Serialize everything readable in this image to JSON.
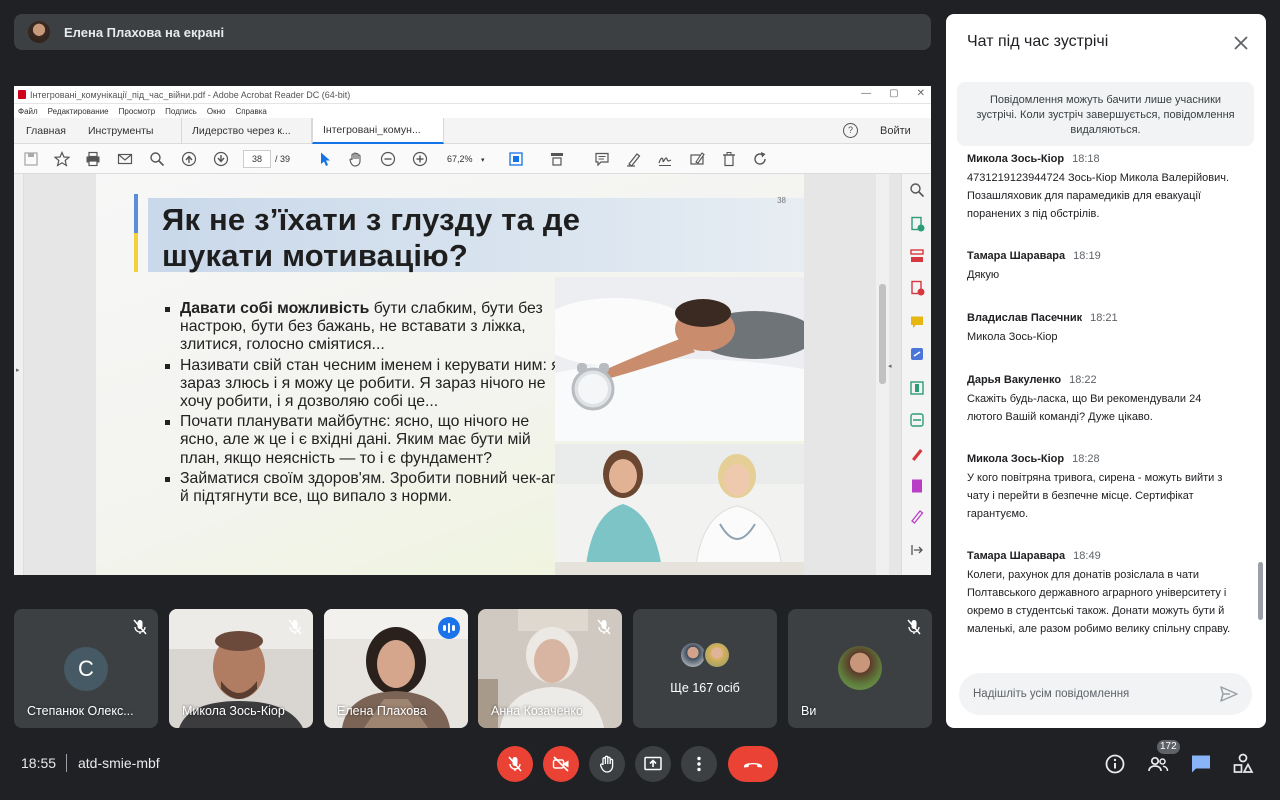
{
  "presenter": {
    "text": "Елена Плахова на екрані"
  },
  "acrobat": {
    "window_title": "Інтегровані_комунікації_під_час_війни.pdf - Adobe Acrobat Reader DC (64-bit)",
    "menu": [
      "Файл",
      "Редактирование",
      "Просмотр",
      "Подпись",
      "Окно",
      "Справка"
    ],
    "tabs": {
      "home": "Главная",
      "tools": "Инструменты",
      "doc1": "Лидерство через к...",
      "doc2": "Інтегровані_комун..."
    },
    "help": "?",
    "login": "Войти",
    "page_current": "38",
    "page_total": "/  39",
    "zoom": "67,2%"
  },
  "slide": {
    "number": "38",
    "title_line1": "Як не з’їхати з глузду та де",
    "title_line2": "шукати мотивацію?",
    "bullets": [
      {
        "bold": "Давати собі можливість",
        "rest": " бути слабким, бути без настрою, бути без бажань, не вставати з ліжка, злитися, голосно сміятися..."
      },
      {
        "bold": "",
        "rest": "Називати свій стан чесним іменем і керувати ним: я зараз злюсь і я можу це робити. Я зараз нічого не хочу робити, і я дозволяю собі це..."
      },
      {
        "bold": "",
        "rest": "Почати планувати майбутнє: ясно, що нічого не ясно, але ж це і є вхідні дані. Яким має бути мій план, якщо неясність — то і є фундамент?"
      },
      {
        "bold": "",
        "rest": "Займатися своїм здоров'ям. Зробити повний чек-ап й підтягнути все, що випало з норми."
      }
    ]
  },
  "participants": [
    {
      "name": "Степанюк Олекс...",
      "avatar_letter": "С"
    },
    {
      "name": "Микола Зось-Кіор"
    },
    {
      "name": "Елена Плахова"
    },
    {
      "name": "Анна Козаченко"
    },
    {
      "name": "Ще 167 осіб"
    },
    {
      "name": "Ви"
    }
  ],
  "bottom": {
    "time": "18:55",
    "meeting_code": "atd-smie-mbf",
    "people_count": "172"
  },
  "chat": {
    "title": "Чат під час зустрічі",
    "notice": "Повідомлення можуть бачити лише учасники зустрічі. Коли зустріч завершується, повідомлення видаляються.",
    "messages": [
      {
        "author": "Микола Зось-Кіор",
        "time": "18:18",
        "text": "4731219123944724  Зось-Кіор Микола Валерійович. Позашляховик для парамедиків для евакуації поранених з під обстрілів."
      },
      {
        "author": "Тамара Шаравара",
        "time": "18:19",
        "text": "Дякую"
      },
      {
        "author": "Владислав Пасечник",
        "time": "18:21",
        "text": "Микола Зось-Кіор"
      },
      {
        "author": "Дарья Вакуленко",
        "time": "18:22",
        "text": "Скажіть будь-ласка, що Ви рекомендували 24 лютого Вашій команді? Дуже цікаво."
      },
      {
        "author": "Микола Зось-Кіор",
        "time": "18:28",
        "text": "У кого повітряна тривога, сирена - можуть вийти з чату і перейти в безпечне місце. Сертифікат гарантуємо."
      },
      {
        "author": "Тамара Шаравара",
        "time": "18:49",
        "text": "Колеги, рахунок для донатів розіслала в чати Полтавського державного аграрного університету і окремо в студентські також. Донати можуть бути й маленькі, але разом робимо велику спільну справу."
      }
    ],
    "input_placeholder": "Надішліть усім повідомлення"
  }
}
